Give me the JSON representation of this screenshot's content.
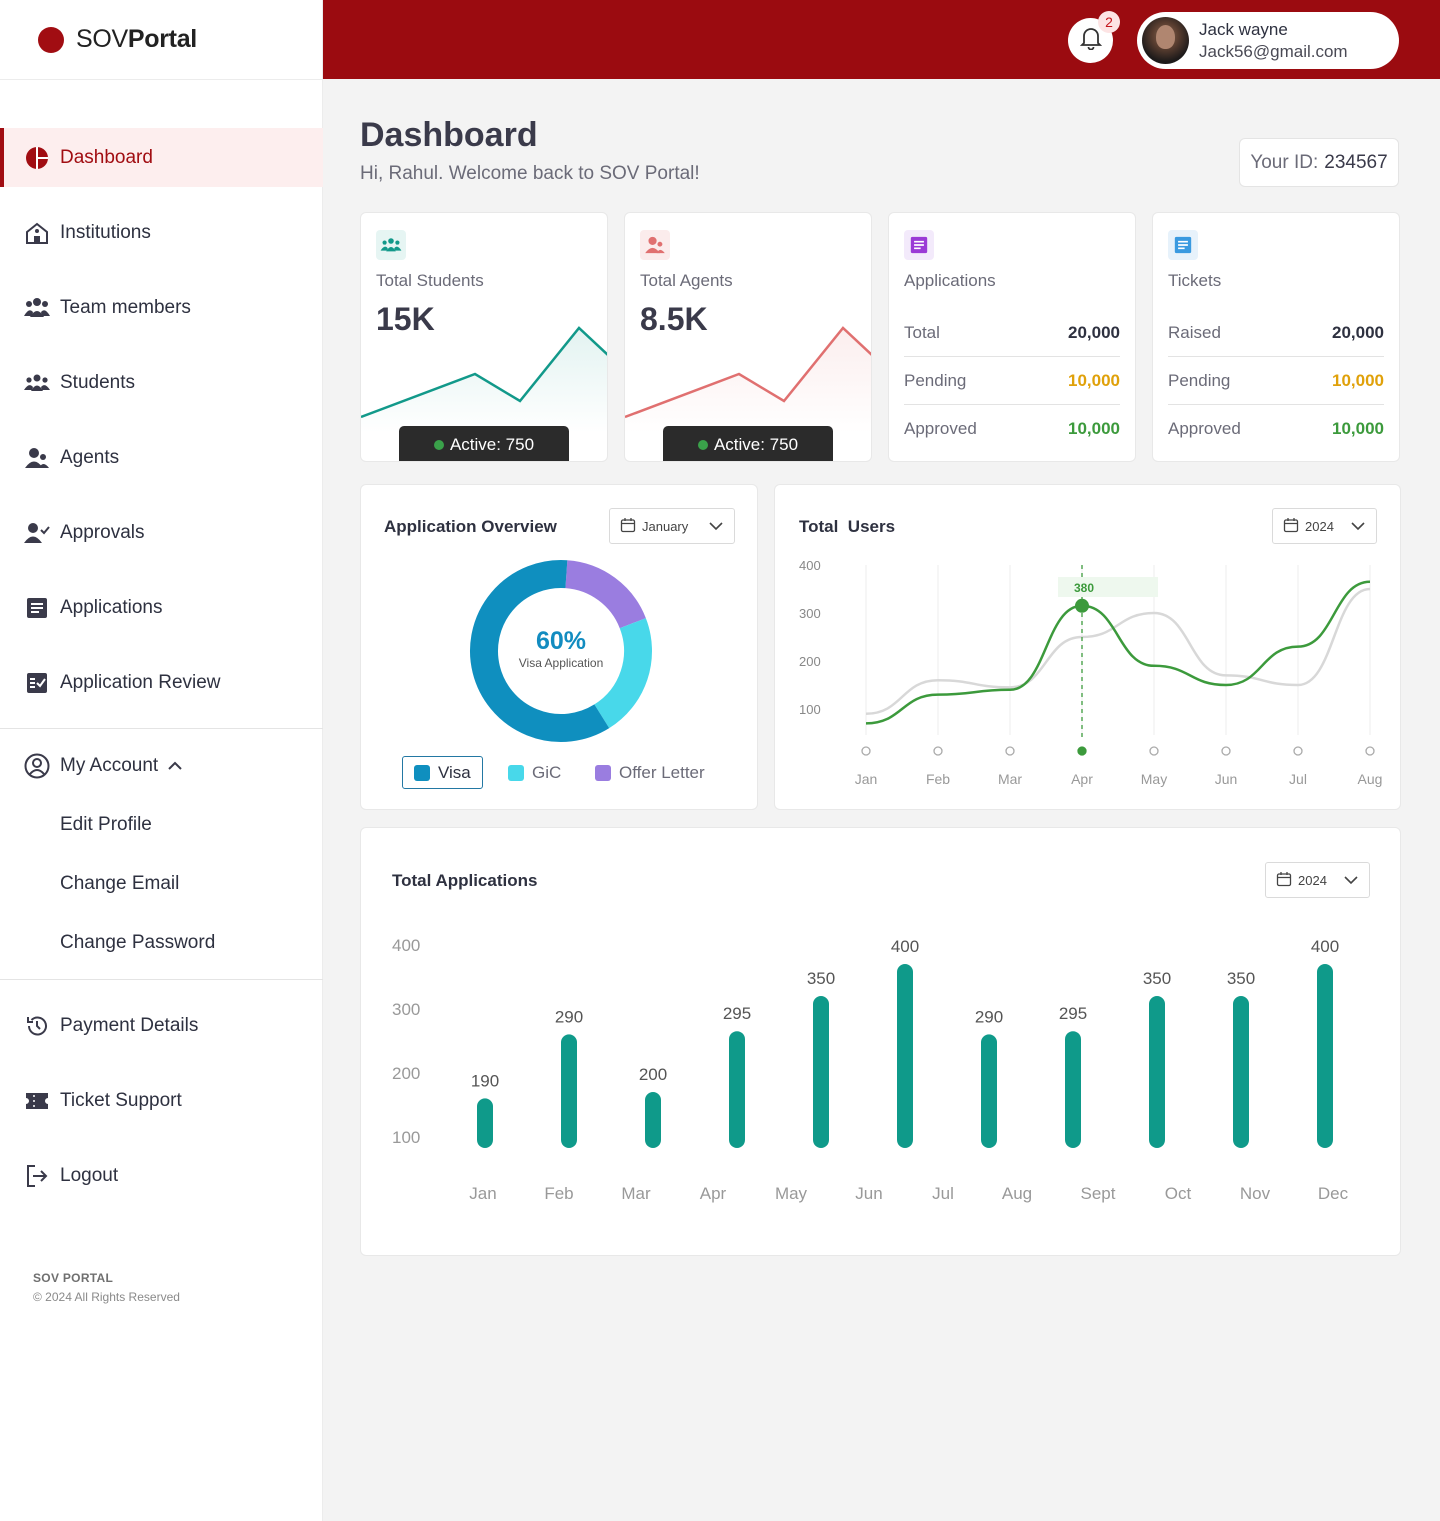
{
  "brand": {
    "prefix": "SOV",
    "suffix": "Portal",
    "color": "#a10d12"
  },
  "header": {
    "notification_count": "2",
    "user_name": "Jack wayne",
    "user_email": "Jack56@gmail.com"
  },
  "sidebar": {
    "items": [
      {
        "label": "Dashboard",
        "icon": "pie-chart-icon",
        "active": true
      },
      {
        "label": "Institutions",
        "icon": "school-icon"
      },
      {
        "label": "Team members",
        "icon": "team-icon"
      },
      {
        "label": "Students",
        "icon": "students-icon"
      },
      {
        "label": "Agents",
        "icon": "agents-icon"
      },
      {
        "label": "Approvals",
        "icon": "user-check-icon"
      },
      {
        "label": "Applications",
        "icon": "document-icon"
      },
      {
        "label": "Application Review",
        "icon": "checklist-icon"
      }
    ],
    "account": {
      "label": "My Account",
      "sub_items": [
        "Edit Profile",
        "Change Email",
        "Change Password"
      ]
    },
    "lower_items": [
      {
        "label": "Payment Details",
        "icon": "history-icon"
      },
      {
        "label": "Ticket Support",
        "icon": "ticket-icon"
      },
      {
        "label": "Logout",
        "icon": "logout-icon"
      }
    ],
    "footer_brand": "SOV PORTAL",
    "footer_copy": "© 2024 All Rights Reserved"
  },
  "main": {
    "title": "Dashboard",
    "welcome": "Hi, Rahul. Welcome back to SOV Portal!",
    "your_id_label": "Your ID:",
    "your_id_value": "234567"
  },
  "stats": {
    "students": {
      "label": "Total Students",
      "value": "15K",
      "active": "Active: 750",
      "color": "#12998a"
    },
    "agents": {
      "label": "Total Agents",
      "value": "8.5K",
      "active": "Active: 750",
      "color": "#e07070"
    },
    "applications": {
      "label": "Applications",
      "rows": [
        {
          "k": "Total",
          "v": "20,000"
        },
        {
          "k": "Pending",
          "v": "10,000"
        },
        {
          "k": "Approved",
          "v": "10,000"
        }
      ]
    },
    "tickets": {
      "label": "Tickets",
      "rows": [
        {
          "k": "Raised",
          "v": "20,000"
        },
        {
          "k": "Pending",
          "v": "10,000"
        },
        {
          "k": "Approved",
          "v": "10,000"
        }
      ]
    }
  },
  "overview": {
    "title": "Application Overview",
    "select": "January",
    "center_value": "60%",
    "center_label": "Visa Application",
    "legend": [
      {
        "label": "Visa",
        "color": "#0f8fbf"
      },
      {
        "label": "GiC",
        "color": "#48d8ea"
      },
      {
        "label": "Offer Letter",
        "color": "#9a7de0"
      }
    ]
  },
  "total_users": {
    "title": "Total  Users",
    "select": "2024",
    "tooltip": "380"
  },
  "total_applications": {
    "title": "Total Applications",
    "select": "2024"
  },
  "chart_data": [
    {
      "type": "pie",
      "title": "Application Overview",
      "categories": [
        "Visa",
        "GiC",
        "Offer Letter"
      ],
      "values": [
        60,
        22,
        18
      ]
    },
    {
      "type": "line",
      "title": "Total  Users",
      "x": [
        "Jan",
        "Feb",
        "Mar",
        "Apr",
        "May",
        "Jun",
        "Jul",
        "Aug"
      ],
      "yticks": [
        400,
        300,
        200,
        100
      ],
      "series": [
        {
          "values": [
            70,
            130,
            140,
            315,
            190,
            150,
            230,
            365
          ],
          "color": "#3c9a3c"
        },
        {
          "values": [
            90,
            160,
            145,
            250,
            300,
            170,
            150,
            350
          ],
          "color": "#d8d8d8"
        }
      ],
      "highlight": {
        "x": "Apr",
        "value": 380
      }
    },
    {
      "type": "bar",
      "title": "Total Applications",
      "categories": [
        "Jan",
        "Feb",
        "Mar",
        "Apr",
        "May",
        "Jun",
        "Jul",
        "Aug",
        "Sept",
        "Oct",
        "Nov",
        "Dec"
      ],
      "values": [
        190,
        290,
        200,
        295,
        350,
        400,
        290,
        295,
        350,
        350,
        400
      ],
      "bar_labels": [
        "190",
        "290",
        "200",
        "295",
        "350",
        "400",
        "290",
        "295",
        "350",
        "350",
        "400"
      ],
      "yticks": [
        400,
        300,
        200,
        100
      ],
      "color": "#0f9a8a"
    }
  ]
}
